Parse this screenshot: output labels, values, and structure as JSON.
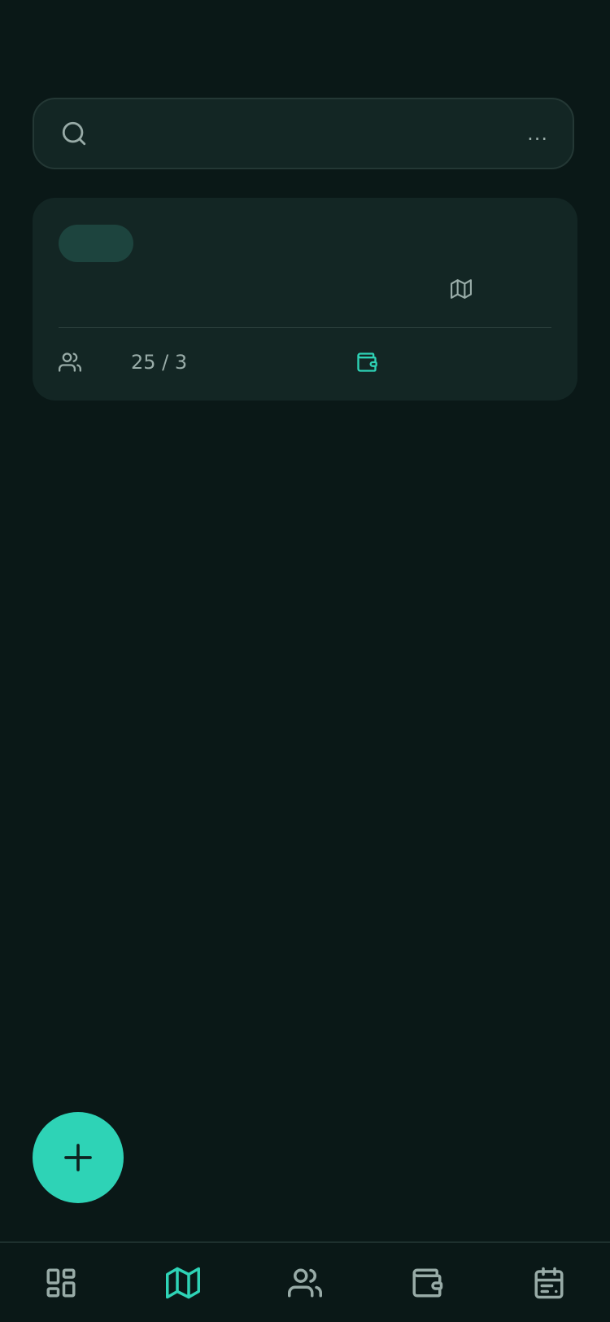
{
  "search": {
    "placeholder": "",
    "more_label": "..."
  },
  "card": {
    "member_count": "25 / 3"
  },
  "colors": {
    "accent": "#2ed3b6",
    "background": "#0a1817",
    "surface": "#132624",
    "muted": "#98aba7",
    "chip": "#1d443e"
  },
  "bottom_nav": {
    "items": [
      {
        "icon": "dashboard-icon",
        "active": false
      },
      {
        "icon": "map-icon",
        "active": true
      },
      {
        "icon": "users-icon",
        "active": false
      },
      {
        "icon": "wallet-icon",
        "active": false
      },
      {
        "icon": "calendar-icon",
        "active": false
      }
    ]
  }
}
